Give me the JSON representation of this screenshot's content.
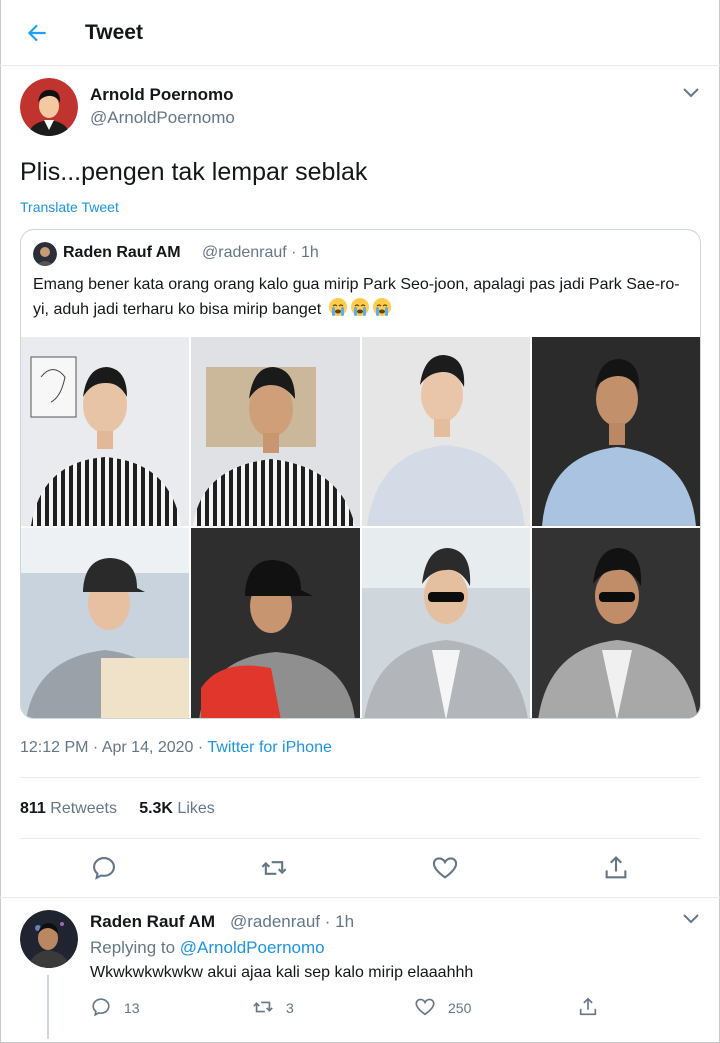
{
  "header": {
    "title": "Tweet",
    "back_icon": "arrow-left-icon"
  },
  "tweet": {
    "author_name": "Arnold Poernomo",
    "author_handle": "@ArnoldPoernomo",
    "text": "Plis...pengen tak lempar seblak",
    "translate_label": "Translate Tweet",
    "timestamp": "12:12 PM · Apr 14, 2020 · ",
    "source": "Twitter for iPhone",
    "retweets_count": "811",
    "retweets_label": " Retweets",
    "likes_count": "5.3K",
    "likes_label": " Likes"
  },
  "quote": {
    "author_name": "Raden Rauf AM",
    "meta": "@radenrauf · 1h",
    "text": "Emang bener kata orang orang kalo gua mirip Park Seo-joon, apalagi pas jadi Park Sae-ro-yi, aduh jadi terharu ko bisa mirip banget",
    "emoji": "crying-face-emoji",
    "photos": [
      {
        "name": "photo-striped-shirt-1",
        "tone": "striped"
      },
      {
        "name": "photo-striped-shirt-2",
        "tone": "striped"
      },
      {
        "name": "photo-blue-shirt-1",
        "tone": "blue-light"
      },
      {
        "name": "photo-blue-shirt-2",
        "tone": "blue-dark"
      },
      {
        "name": "photo-cap-1",
        "tone": "cap-light"
      },
      {
        "name": "photo-cap-2",
        "tone": "cap-dark"
      },
      {
        "name": "photo-sunglasses-1",
        "tone": "grey-light"
      },
      {
        "name": "photo-sunglasses-2",
        "tone": "grey-dark"
      }
    ]
  },
  "reply": {
    "author_name": "Raden Rauf AM",
    "meta": "@radenrauf · 1h",
    "replying_prefix": "Replying to ",
    "replying_to": "@ArnoldPoernomo",
    "text": "Wkwkwkwkwkw akui ajaa kali sep kalo mirip elaaahhh",
    "reply_count": "13",
    "retweet_count": "3",
    "like_count": "250"
  },
  "colors": {
    "accent": "#1b95e0",
    "secondary_text": "#657786",
    "divider": "#e6ecf0"
  }
}
